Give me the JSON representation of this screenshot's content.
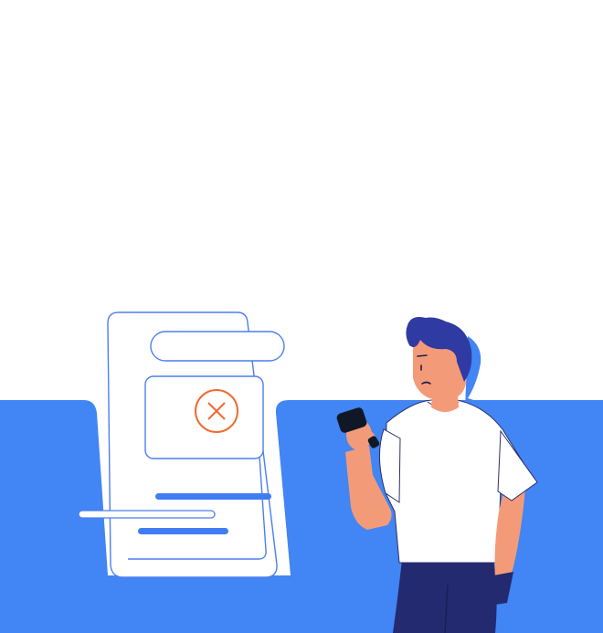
{
  "illustration": {
    "subject": "error-state",
    "status_icon": "error-x-icon",
    "status": "error"
  },
  "colors": {
    "background": "#ffffff",
    "accent_blue": "#4285f4",
    "outline_blue": "#4c7ef0",
    "bar_blue": "#3f7df2",
    "error_orange": "#f06a32",
    "hair_navy": "#2f3aa3",
    "pants_navy": "#232a70",
    "skin": "#f39b78",
    "phone_dark": "#101828",
    "shirt_white": "#ffffff"
  }
}
